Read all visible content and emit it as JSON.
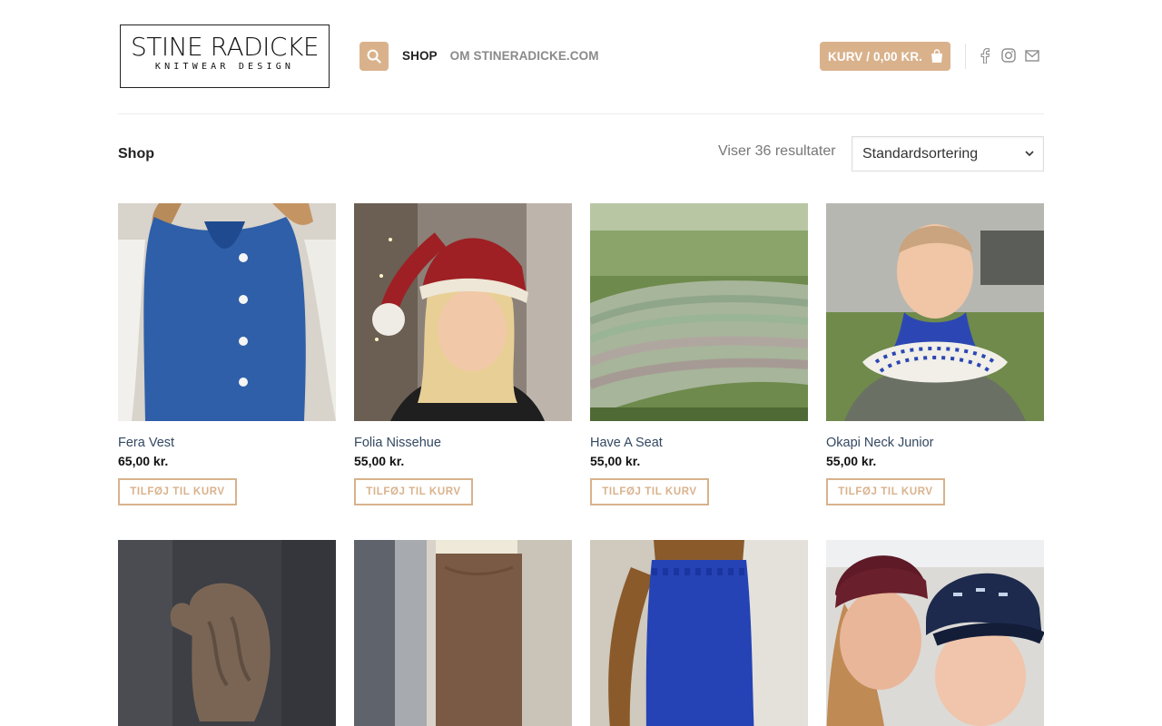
{
  "header": {
    "logo_main": "STINE RADICKE",
    "logo_sub": "KNITWEAR DESIGN",
    "nav": [
      "SHOP",
      "OM STINERADICKE.COM"
    ],
    "cart_label": "KURV / 0,00 KR."
  },
  "toolbar": {
    "breadcrumb": "Shop",
    "results": "Viser 36 resultater",
    "sort_selected": "Standardsortering"
  },
  "products": [
    {
      "name": "Fera Vest",
      "price": "65,00 kr.",
      "button": "TILFØJ TIL KURV"
    },
    {
      "name": "Folia Nissehue",
      "price": "55,00 kr.",
      "button": "TILFØJ TIL KURV"
    },
    {
      "name": "Have A Seat",
      "price": "55,00 kr.",
      "button": "TILFØJ TIL KURV"
    },
    {
      "name": "Okapi Neck Junior",
      "price": "55,00 kr.",
      "button": "TILFØJ TIL KURV"
    },
    {
      "name": "",
      "price": "",
      "button": ""
    },
    {
      "name": "",
      "price": "",
      "button": ""
    },
    {
      "name": "",
      "price": "",
      "button": ""
    },
    {
      "name": "",
      "price": "",
      "button": ""
    }
  ],
  "colors": {
    "accent": "#d9b28c",
    "product_link": "#334862"
  },
  "icons": [
    "search-icon",
    "shopping-bag-icon",
    "facebook-icon",
    "instagram-icon",
    "email-icon",
    "chevron-down-icon"
  ]
}
